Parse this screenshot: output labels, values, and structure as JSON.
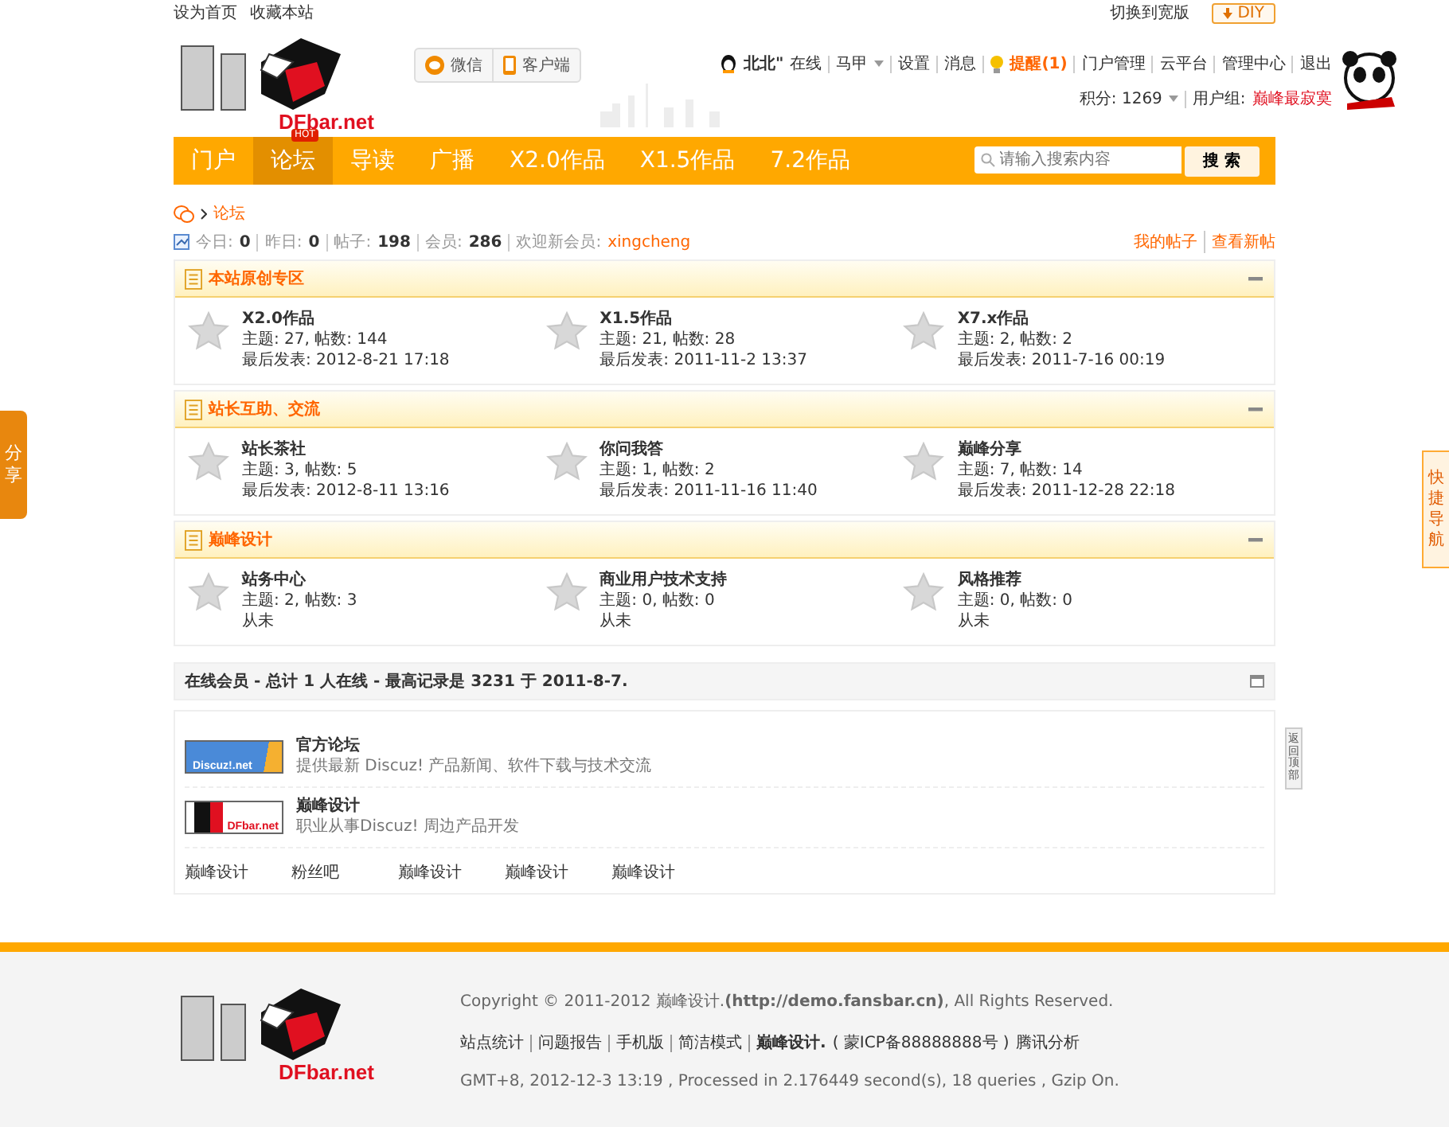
{
  "topbar": {
    "left_links": [
      "设为首页",
      "收藏本站"
    ],
    "switch_link": "切换到宽版",
    "diy_button": "DIY"
  },
  "header": {
    "logo_text": "DFbar.net",
    "app_buttons": [
      {
        "label": "微信",
        "kind": "chat"
      },
      {
        "label": "客户端",
        "kind": "phone"
      }
    ],
    "user": {
      "name": "北北\"",
      "status": "在线",
      "vest": "马甲",
      "links": [
        "设置",
        "消息"
      ],
      "reminder": "提醒(1)",
      "admin_links": [
        "门户管理",
        "云平台",
        "管理中心",
        "退出"
      ],
      "credits": "积分: 1269",
      "group_label": "用户组: ",
      "group": "巅峰最寂寞"
    }
  },
  "nav": {
    "items": [
      {
        "label": "门户",
        "selected": false
      },
      {
        "label": "论坛",
        "selected": true,
        "badge": "HOT"
      },
      {
        "label": "导读",
        "selected": false
      },
      {
        "label": "广播",
        "selected": false
      },
      {
        "label": "X2.0作品",
        "selected": false
      },
      {
        "label": "X1.5作品",
        "selected": false
      },
      {
        "label": "7.2作品",
        "selected": false
      }
    ],
    "search": {
      "placeholder": "请输入搜索内容",
      "button": "搜 索"
    }
  },
  "breadcrumb": [
    "论坛"
  ],
  "stats": {
    "items": [
      {
        "label": "今日: ",
        "value": "0"
      },
      {
        "label": "昨日: ",
        "value": "0"
      },
      {
        "label": "帖子: ",
        "value": "198"
      },
      {
        "label": "会员: ",
        "value": "286"
      }
    ],
    "new_member_label": "欢迎新会员: ",
    "new_member": "xingcheng",
    "right_links": [
      "我的帖子",
      "查看新帖"
    ]
  },
  "categories": [
    {
      "title": "本站原创专区",
      "forums": [
        {
          "name": "X2.0作品",
          "counts": "主题: 27, 帖数: 144",
          "last": "最后发表: 2012-8-21 17:18"
        },
        {
          "name": "X1.5作品",
          "counts": "主题: 21, 帖数: 28",
          "last": "最后发表: 2011-11-2 13:37"
        },
        {
          "name": "X7.x作品",
          "counts": "主题: 2, 帖数: 2",
          "last": "最后发表: 2011-7-16 00:19"
        }
      ]
    },
    {
      "title": "站长互助、交流",
      "forums": [
        {
          "name": "站长茶社",
          "counts": "主题: 3, 帖数: 5",
          "last": "最后发表: 2012-8-11 13:16"
        },
        {
          "name": "你问我答",
          "counts": "主题: 1, 帖数: 2",
          "last": "最后发表: 2011-11-16 11:40"
        },
        {
          "name": "巅峰分享",
          "counts": "主题: 7, 帖数: 14",
          "last": "最后发表: 2011-12-28 22:18"
        }
      ]
    },
    {
      "title": "巅峰设计",
      "forums": [
        {
          "name": "站务中心",
          "counts": "主题: 2, 帖数: 3",
          "last": "从未"
        },
        {
          "name": "商业用户技术支持",
          "counts": "主题: 0, 帖数: 0",
          "last": "从未"
        },
        {
          "name": "风格推荐",
          "counts": "主题: 0, 帖数: 0",
          "last": "从未"
        }
      ]
    }
  ],
  "online": {
    "title": "在线会员 - 总计 1 人在线 - 最高记录是 3231 于 2011-8-7."
  },
  "friend_links": {
    "image_links": [
      {
        "kind": "discuz",
        "banner_text": "Discuz!.net",
        "title": "官方论坛",
        "desc": "提供最新 Discuz! 产品新闻、软件下载与技术交流"
      },
      {
        "kind": "dfbar",
        "banner_text": "DFbar.net",
        "title": "巅峰设计",
        "desc": "职业从事Discuz! 周边产品开发"
      }
    ],
    "text_links": [
      "巅峰设计",
      "粉丝吧",
      "巅峰设计",
      "巅峰设计",
      "巅峰设计"
    ]
  },
  "footer": {
    "logo_text": "DFbar.net",
    "copyright": "Copyright © 2011-2012 巅峰设计.**(http://demo.fansbar.cn)**, All Rights Reserved.",
    "links": [
      "站点统计",
      "问题报告",
      "手机版",
      "简洁模式"
    ],
    "site": "巅峰设计.",
    "icp": "( 蒙ICP备88888888号 )",
    "extra": "腾讯分析",
    "processed": "GMT+8, 2012-12-3 13:19 , Processed in 2.176449 second(s), 18 queries , Gzip On."
  },
  "side_tabs": {
    "share": "分享",
    "quick_nav": "快捷导航",
    "back_top": "返回顶部"
  }
}
